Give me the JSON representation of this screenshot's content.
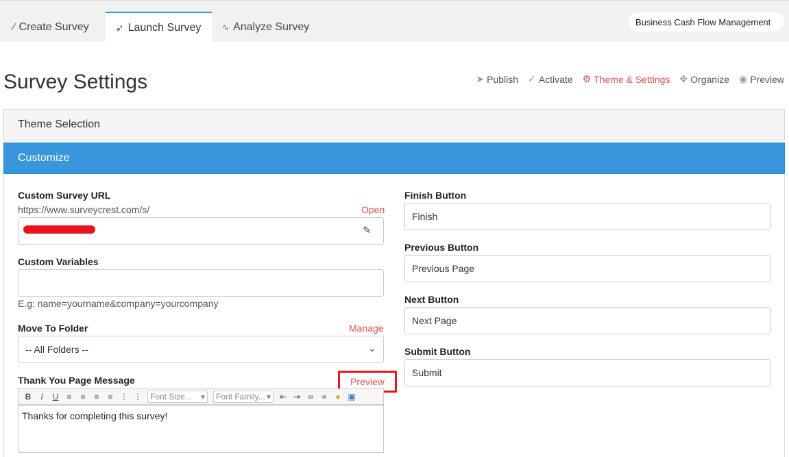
{
  "tabs": [
    {
      "label": "Create Survey",
      "icon": "magic-wand-icon"
    },
    {
      "label": "Launch Survey",
      "icon": "rocket-icon"
    },
    {
      "label": "Analyze Survey",
      "icon": "chart-line-icon"
    }
  ],
  "survey_name": "Business Cash Flow Management",
  "page_title": "Survey Settings",
  "actions": [
    {
      "label": "Publish",
      "icon": "send-icon"
    },
    {
      "label": "Activate",
      "icon": "check-icon"
    },
    {
      "label": "Theme & Settings",
      "icon": "gear-icon"
    },
    {
      "label": "Organize",
      "icon": "move-icon"
    },
    {
      "label": "Preview",
      "icon": "eye-icon"
    }
  ],
  "panels": {
    "theme_selection": "Theme Selection",
    "customize": "Customize"
  },
  "left": {
    "url_label": "Custom Survey URL",
    "url_base": "https://www.surveycrest.com/s/",
    "open_label": "Open",
    "vars_label": "Custom Variables",
    "vars_value": "",
    "vars_hint": "E.g: name=yourname&company=yourcompany",
    "folder_label": "Move To Folder",
    "manage_label": "Manage",
    "folder_value": "-- All Folders --",
    "thankyou_label": "Thank You Page Message",
    "preview_label": "Preview",
    "font_size_placeholder": "Font Size...",
    "font_family_placeholder": "Font Family...",
    "thankyou_text": "Thanks for completing this survey!"
  },
  "right": {
    "finish_label": "Finish Button",
    "finish_value": "Finish",
    "previous_label": "Previous Button",
    "previous_value": "Previous Page",
    "next_label": "Next Button",
    "next_value": "Next Page",
    "submit_label": "Submit Button",
    "submit_value": "Submit"
  },
  "colors": {
    "accent_blue": "#3897dc",
    "link_red": "#d9534f",
    "highlight_red": "#e5181e"
  }
}
